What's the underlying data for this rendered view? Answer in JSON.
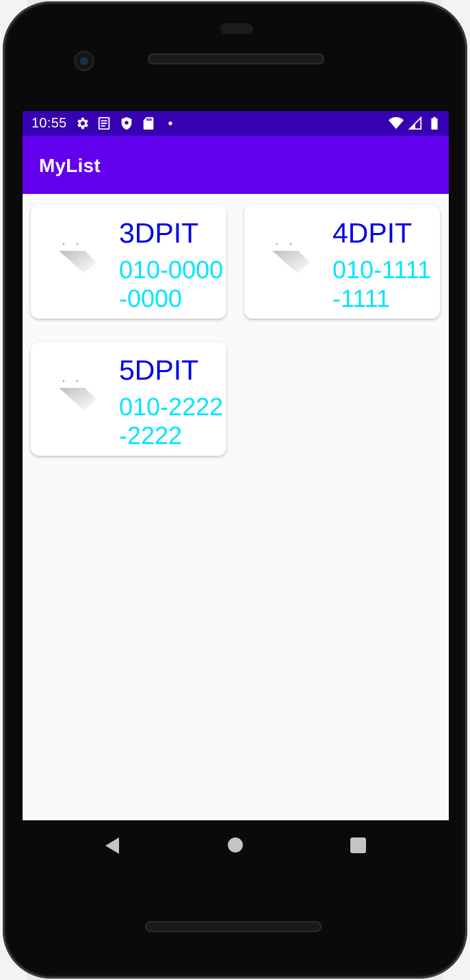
{
  "status_bar": {
    "time": "10:55",
    "left_icons": [
      "settings-icon",
      "notes-icon",
      "shield-icon",
      "sd-card-icon",
      "dot-icon"
    ],
    "right_icons": [
      "wifi-icon",
      "signal-icon",
      "battery-icon"
    ]
  },
  "app_bar": {
    "title": "MyList"
  },
  "contacts": [
    {
      "name": "3DPIT",
      "phone": "010-0000-0000"
    },
    {
      "name": "4DPIT",
      "phone": "010-1111-1111"
    },
    {
      "name": "5DPIT",
      "phone": "010-2222-2222"
    }
  ],
  "nav_bar": {
    "buttons": [
      "back-icon",
      "home-icon",
      "recent-apps-icon"
    ]
  },
  "colors": {
    "status_bar": "#3700b3",
    "app_bar": "#6200ee",
    "name_text": "#0000e5",
    "phone_text": "#00e5ff",
    "screen_bg": "#fafafa"
  }
}
